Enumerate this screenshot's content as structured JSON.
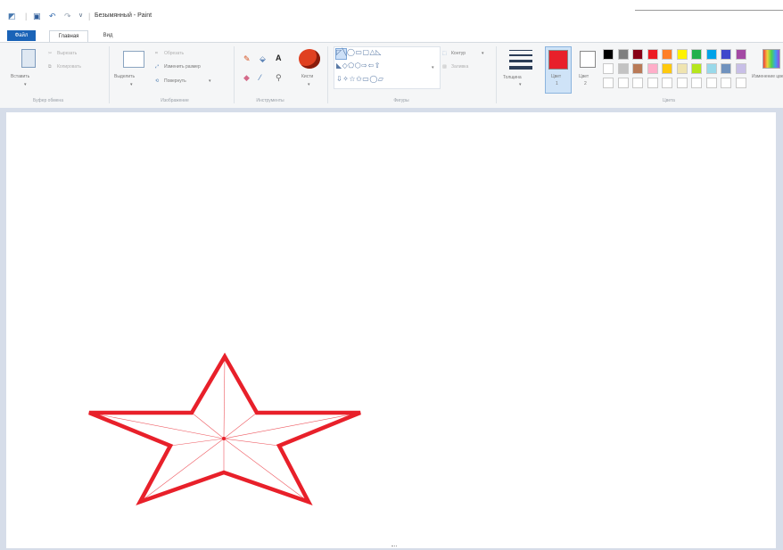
{
  "titlebar": {
    "title": "Безымянный - Paint",
    "quick_access": [
      "paint-app-icon",
      "save-icon",
      "undo-icon",
      "redo-icon",
      "customize-chevron-icon"
    ]
  },
  "tabs": {
    "file": "Файл",
    "home": "Главная",
    "view": "Вид"
  },
  "groups": {
    "clipboard": "Буфер обмена",
    "image": "Изображение",
    "tools": "Инструменты",
    "shapes": "Фигуры",
    "colors": "Цвета"
  },
  "clipboard": {
    "paste": "Вставить",
    "cut": "Вырезать",
    "copy": "Копировать"
  },
  "image": {
    "select": "Выделить",
    "crop": "Обрезать",
    "resize": "Изменить размер",
    "rotate": "Повернуть"
  },
  "tools": {
    "brushes": "Кисти",
    "icons": [
      "pencil-icon",
      "fill-icon",
      "text-icon",
      "eraser-icon",
      "color-picker-icon",
      "magnifier-icon"
    ]
  },
  "shapes": {
    "outline": "Контур",
    "fill": "Заливка",
    "row1": "◸╲◯▭▢△◺",
    "row2": "◣◇⬠⬡⇨⇦⇧",
    "row3": "⇩✧☆✩▭◯▱"
  },
  "size": {
    "label": "Толщина"
  },
  "colors": {
    "color1_label": "Цвет",
    "color1_num": "1",
    "color2_label": "Цвет",
    "color2_num": "2",
    "edit": "Изменение цветов",
    "color1_value": "#e8202a",
    "color2_value": "#ffffff",
    "palette_row1": [
      "#000000",
      "#7f7f7f",
      "#880015",
      "#ed1c24",
      "#ff7f27",
      "#fff200",
      "#22b14c",
      "#00a2e8",
      "#3f48cc",
      "#a349a4"
    ],
    "palette_row2": [
      "#ffffff",
      "#c3c3c3",
      "#b97a57",
      "#ffaec9",
      "#ffc90e",
      "#efe4b0",
      "#b5e61d",
      "#99d9ea",
      "#7092be",
      "#c8bfe7"
    ],
    "palette_row3": [
      "#ffffff",
      "#ffffff",
      "#ffffff",
      "#ffffff",
      "#ffffff",
      "#ffffff",
      "#ffffff",
      "#ffffff",
      "#ffffff",
      "#ffffff"
    ]
  },
  "canvas": {
    "star_color": "#e8202a"
  }
}
